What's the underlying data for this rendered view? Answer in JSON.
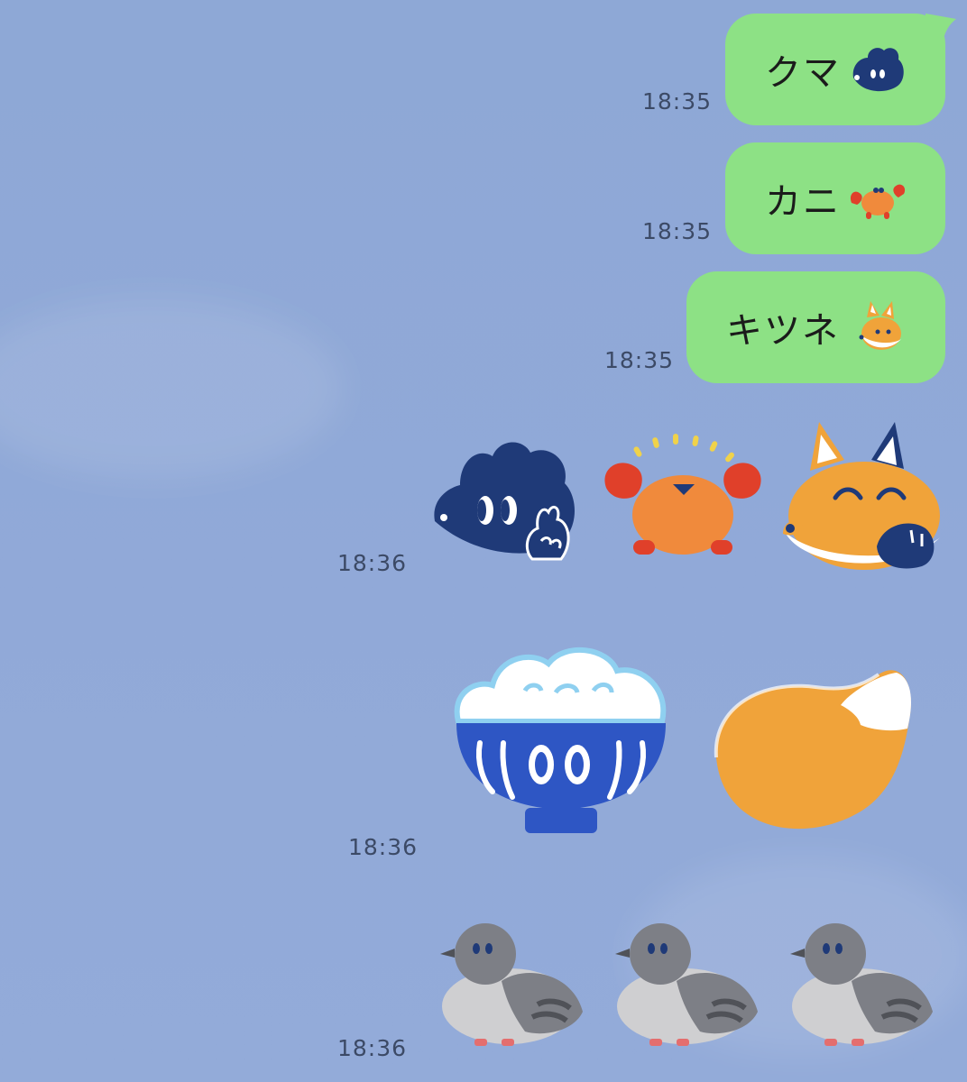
{
  "chat": {
    "messages": [
      {
        "text": "クマ",
        "time": "18:35",
        "emoji": "bear-emoji"
      },
      {
        "text": "カニ",
        "time": "18:35",
        "emoji": "crab-emoji"
      },
      {
        "text": "キツネ",
        "time": "18:35",
        "emoji": "fox-emoji"
      }
    ],
    "sticker_rows": [
      {
        "time": "18:36",
        "stickers": [
          "bear-peace-sticker",
          "crab-sticker",
          "fox-sleepy-sticker"
        ]
      },
      {
        "time": "18:36",
        "stickers": [
          "rice-bowl-sticker",
          "fox-tail-sticker"
        ]
      },
      {
        "time": "18:36",
        "stickers": [
          "pigeon-sticker",
          "pigeon-sticker",
          "pigeon-sticker"
        ]
      }
    ]
  },
  "colors": {
    "background": "#8fa9d7",
    "bubble": "#8de185",
    "timestamp": "#3c4a66",
    "bear_navy": "#1f3a78",
    "fox_orange": "#f0a33a",
    "crab_red": "#e0402a",
    "bowl_blue": "#2e56c4",
    "pigeon_gray": "#7d7f86"
  }
}
